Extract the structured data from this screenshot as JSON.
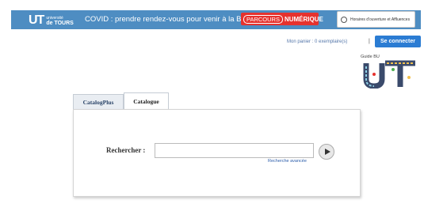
{
  "header": {
    "logo": {
      "mark": "UT",
      "line1": "université",
      "line2": "de TOURS"
    },
    "covid_text": "COVID : prendre rendez-vous pour venir à la BU",
    "parcours": {
      "part1": "PARCOURS",
      "part2": "NUMÉRIQUE"
    },
    "horaires": "Horaires d'ouverture et Affluences"
  },
  "account": {
    "panier": "Mon panier : 0 exemplaire(s)",
    "separator": "|",
    "connect_label": "Se connecter"
  },
  "guide": {
    "label": "Guide BU"
  },
  "tabs": [
    {
      "label": "CatalogPlus",
      "active": false
    },
    {
      "label": "Catalogue",
      "active": true
    }
  ],
  "search": {
    "label": "Rechercher :",
    "value": "",
    "advanced_link": "Recherche avancée"
  },
  "colors": {
    "header_bg": "#4e8dc2",
    "parcours_bg": "#e6322e",
    "connect_bg": "#2b7cd3"
  },
  "icons": [
    "clock-icon",
    "play-arrow-icon"
  ]
}
